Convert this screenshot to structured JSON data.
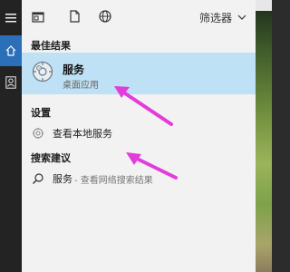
{
  "topbar": {
    "filter_label": "筛选器",
    "icons": [
      "apps-icon",
      "document-icon",
      "globe-icon",
      "chevron-down-icon"
    ]
  },
  "sections": {
    "best_match": "最佳结果",
    "settings": "设置",
    "search_suggestions": "搜索建议"
  },
  "best_match": {
    "title": "服务",
    "subtitle": "桌面应用",
    "icon": "gear-icon"
  },
  "settings_items": [
    {
      "label": "查看本地服务",
      "icon": "settings-service-icon"
    }
  ],
  "suggestions": [
    {
      "label": "服务",
      "sub": "- 查看网络搜索结果",
      "icon": "search-icon"
    }
  ],
  "left_rail": [
    "hamburger-icon",
    "home-icon",
    "person-icon"
  ],
  "colors": {
    "highlight": "#bfe1f5",
    "rail_active": "#2a6fb8",
    "arrow": "#e33cdb"
  }
}
